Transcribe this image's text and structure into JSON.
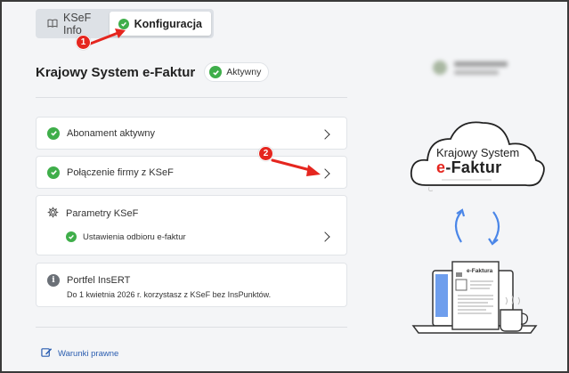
{
  "tabs": [
    {
      "label": "KSeF Info",
      "icon": "book-icon",
      "active": false
    },
    {
      "label": "Konfiguracja",
      "icon": "check-circle-icon",
      "active": true
    }
  ],
  "header": {
    "title": "Krajowy System e-Faktur",
    "status": "Aktywny"
  },
  "items": {
    "subscription": {
      "label": "Abonament aktywny"
    },
    "connection": {
      "label": "Połączenie firmy z KSeF"
    },
    "parameters": {
      "label": "Parametry KSeF",
      "sub_label": "Ustawienia odbioru e-faktur"
    },
    "portfolio": {
      "title": "Portfel InsERT",
      "text": "Do 1 kwietnia 2026 r. korzystasz z KSeF bez InsPunktów."
    }
  },
  "footer": {
    "legal_link": "Warunki prawne"
  },
  "illustration": {
    "cloud_line1": "Krajowy System",
    "cloud_e": "e",
    "cloud_line2": "-Faktur",
    "document_label": "e-Faktura"
  },
  "annotations": {
    "step1": "1",
    "step2": "2"
  },
  "colors": {
    "accent_green": "#3fae4a",
    "annotation_red": "#e5261f",
    "link_blue": "#2a5db0",
    "arrow_blue": "#4a86e8"
  }
}
